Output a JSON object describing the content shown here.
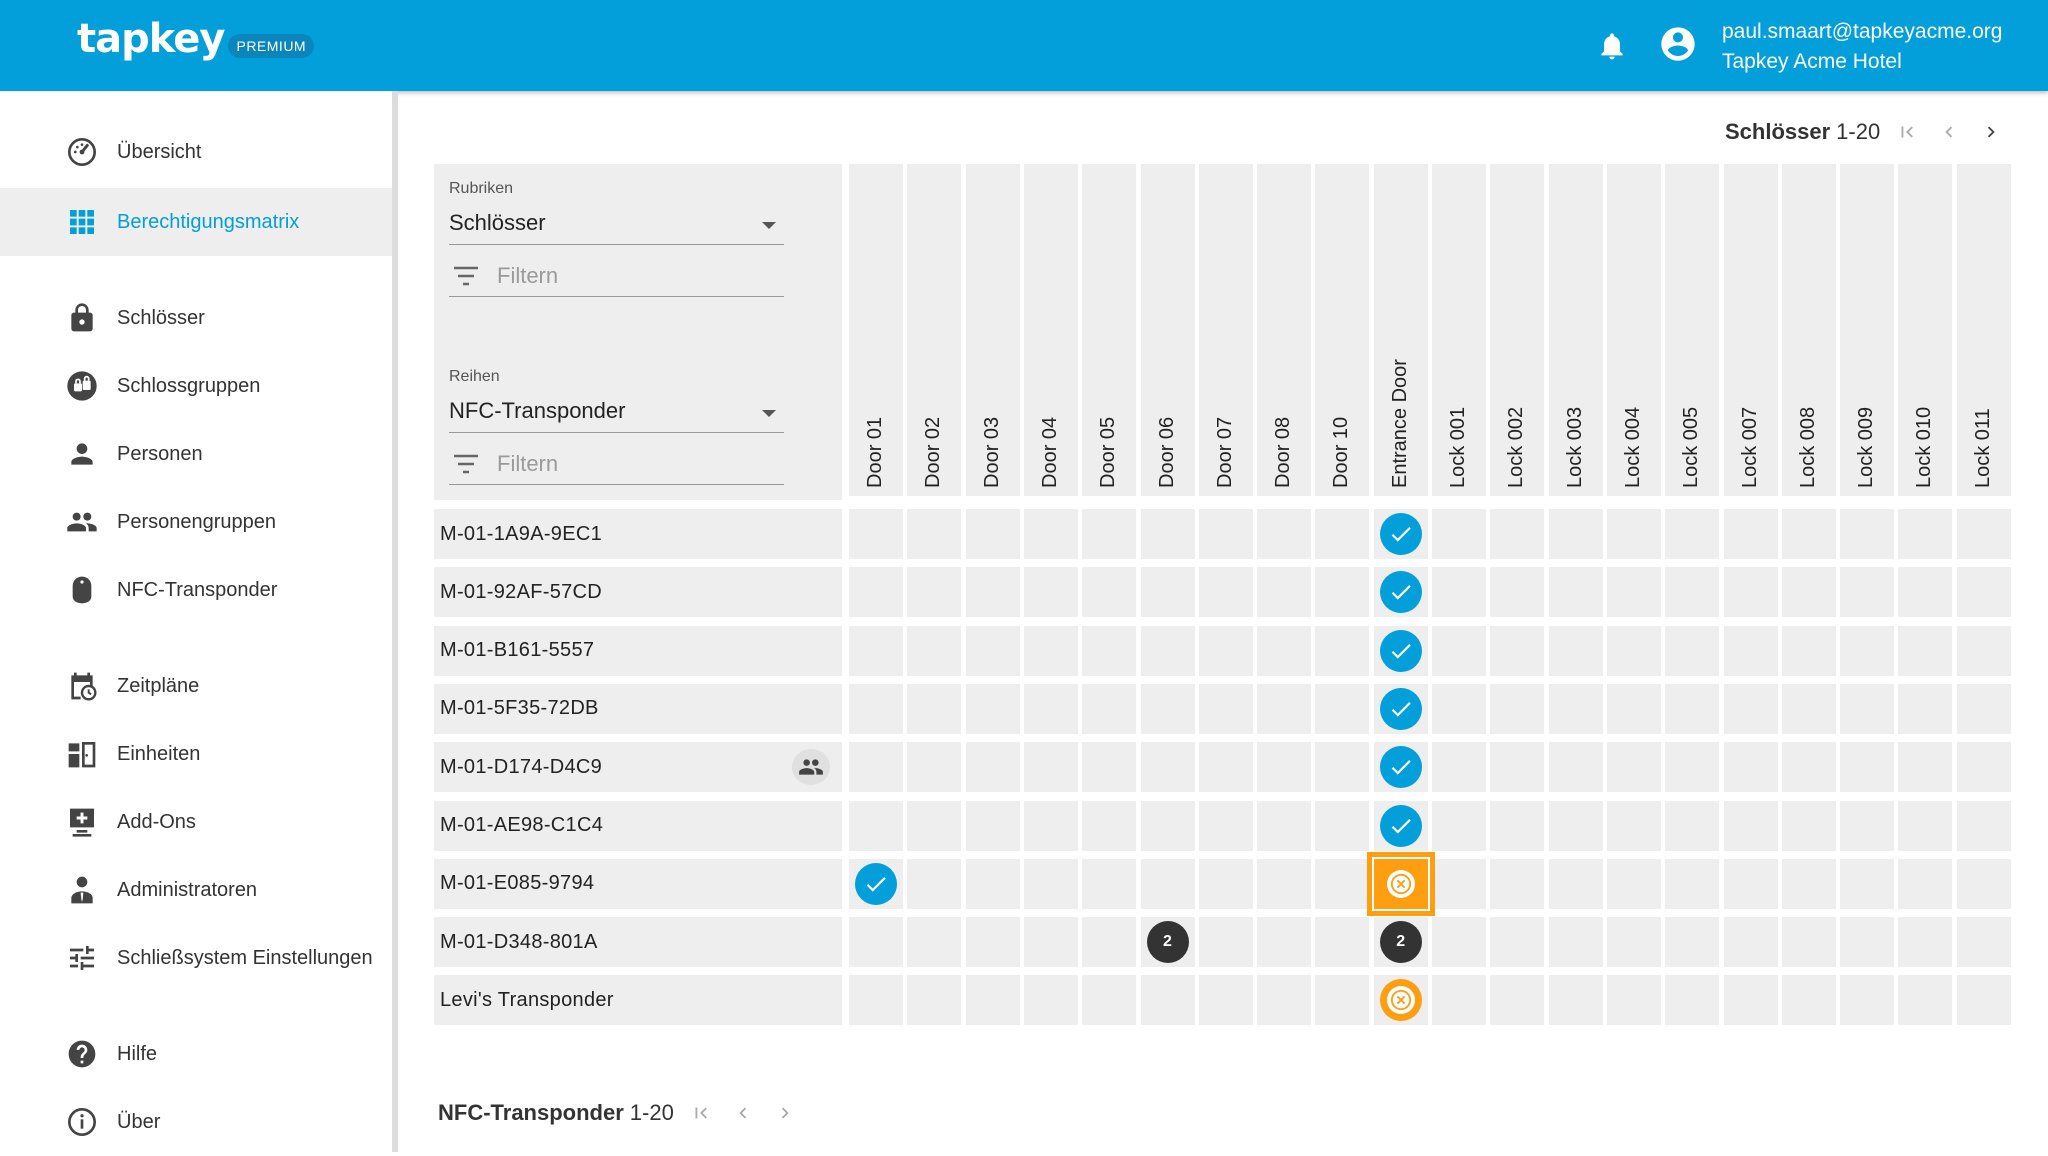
{
  "header": {
    "logo": "tapkey",
    "badge": "PREMIUM",
    "user_email": "paul.smaart@tapkeyacme.org",
    "user_org": "Tapkey Acme Hotel",
    "bar_color": "#039fdb"
  },
  "sidebar": {
    "items": [
      {
        "label": "Übersicht",
        "icon": "dashboard-icon"
      },
      {
        "label": "Berechtigungsmatrix",
        "icon": "grid-icon",
        "active": true
      },
      {
        "label": "Schlösser",
        "icon": "lock-icon"
      },
      {
        "label": "Schlossgruppen",
        "icon": "lock-group-icon"
      },
      {
        "label": "Personen",
        "icon": "person-icon"
      },
      {
        "label": "Personengruppen",
        "icon": "people-icon"
      },
      {
        "label": "NFC-Transponder",
        "icon": "transponder-icon"
      },
      {
        "label": "Zeitpläne",
        "icon": "schedule-icon"
      },
      {
        "label": "Einheiten",
        "icon": "unit-icon"
      },
      {
        "label": "Add-Ons",
        "icon": "addon-icon"
      },
      {
        "label": "Administratoren",
        "icon": "admin-icon"
      },
      {
        "label": "Schließsystem Einstellungen",
        "icon": "settings-sliders-icon"
      },
      {
        "label": "Hilfe",
        "icon": "help-icon"
      },
      {
        "label": "Über",
        "icon": "info-icon"
      }
    ]
  },
  "top_pager": {
    "label": "Schlösser",
    "range": "1-20"
  },
  "bottom_pager": {
    "label": "NFC-Transponder",
    "range": "1-20"
  },
  "filters": {
    "rubriken": {
      "caption": "Rubriken",
      "value": "Schlösser",
      "placeholder": "Filtern"
    },
    "reihen": {
      "caption": "Reihen",
      "value": "NFC-Transponder",
      "placeholder": "Filtern"
    }
  },
  "matrix": {
    "columns": [
      "Door 01",
      "Door 02",
      "Door 03",
      "Door 04",
      "Door 05",
      "Door 06",
      "Door 07",
      "Door 08",
      "Door 10",
      "Entrance Door",
      "Lock 001",
      "Lock 002",
      "Lock 003",
      "Lock 004",
      "Lock 005",
      "Lock 007",
      "Lock 008",
      "Lock 009",
      "Lock 010",
      "Lock 011"
    ],
    "rows": [
      {
        "label": "M-01-1A9A-9EC1",
        "group": false
      },
      {
        "label": "M-01-92AF-57CD",
        "group": false
      },
      {
        "label": "M-01-B161-5557",
        "group": false
      },
      {
        "label": "M-01-5F35-72DB",
        "group": false
      },
      {
        "label": "M-01-D174-D4C9",
        "group": true
      },
      {
        "label": "M-01-AE98-C1C4",
        "group": false
      },
      {
        "label": "M-01-E085-9794",
        "group": false
      },
      {
        "label": "M-01-D348-801A",
        "group": false
      },
      {
        "label": "Levi's Transponder",
        "group": false
      }
    ],
    "cells": [
      {
        "row": 0,
        "col": 9,
        "type": "check"
      },
      {
        "row": 1,
        "col": 9,
        "type": "check"
      },
      {
        "row": 2,
        "col": 9,
        "type": "check"
      },
      {
        "row": 3,
        "col": 9,
        "type": "check"
      },
      {
        "row": 4,
        "col": 9,
        "type": "check"
      },
      {
        "row": 5,
        "col": 9,
        "type": "check"
      },
      {
        "row": 6,
        "col": 0,
        "type": "check"
      },
      {
        "row": 6,
        "col": 9,
        "type": "warn",
        "highlighted": true
      },
      {
        "row": 7,
        "col": 5,
        "type": "count",
        "value": "2"
      },
      {
        "row": 7,
        "col": 9,
        "type": "count",
        "value": "2"
      },
      {
        "row": 8,
        "col": 9,
        "type": "warn"
      }
    ]
  }
}
